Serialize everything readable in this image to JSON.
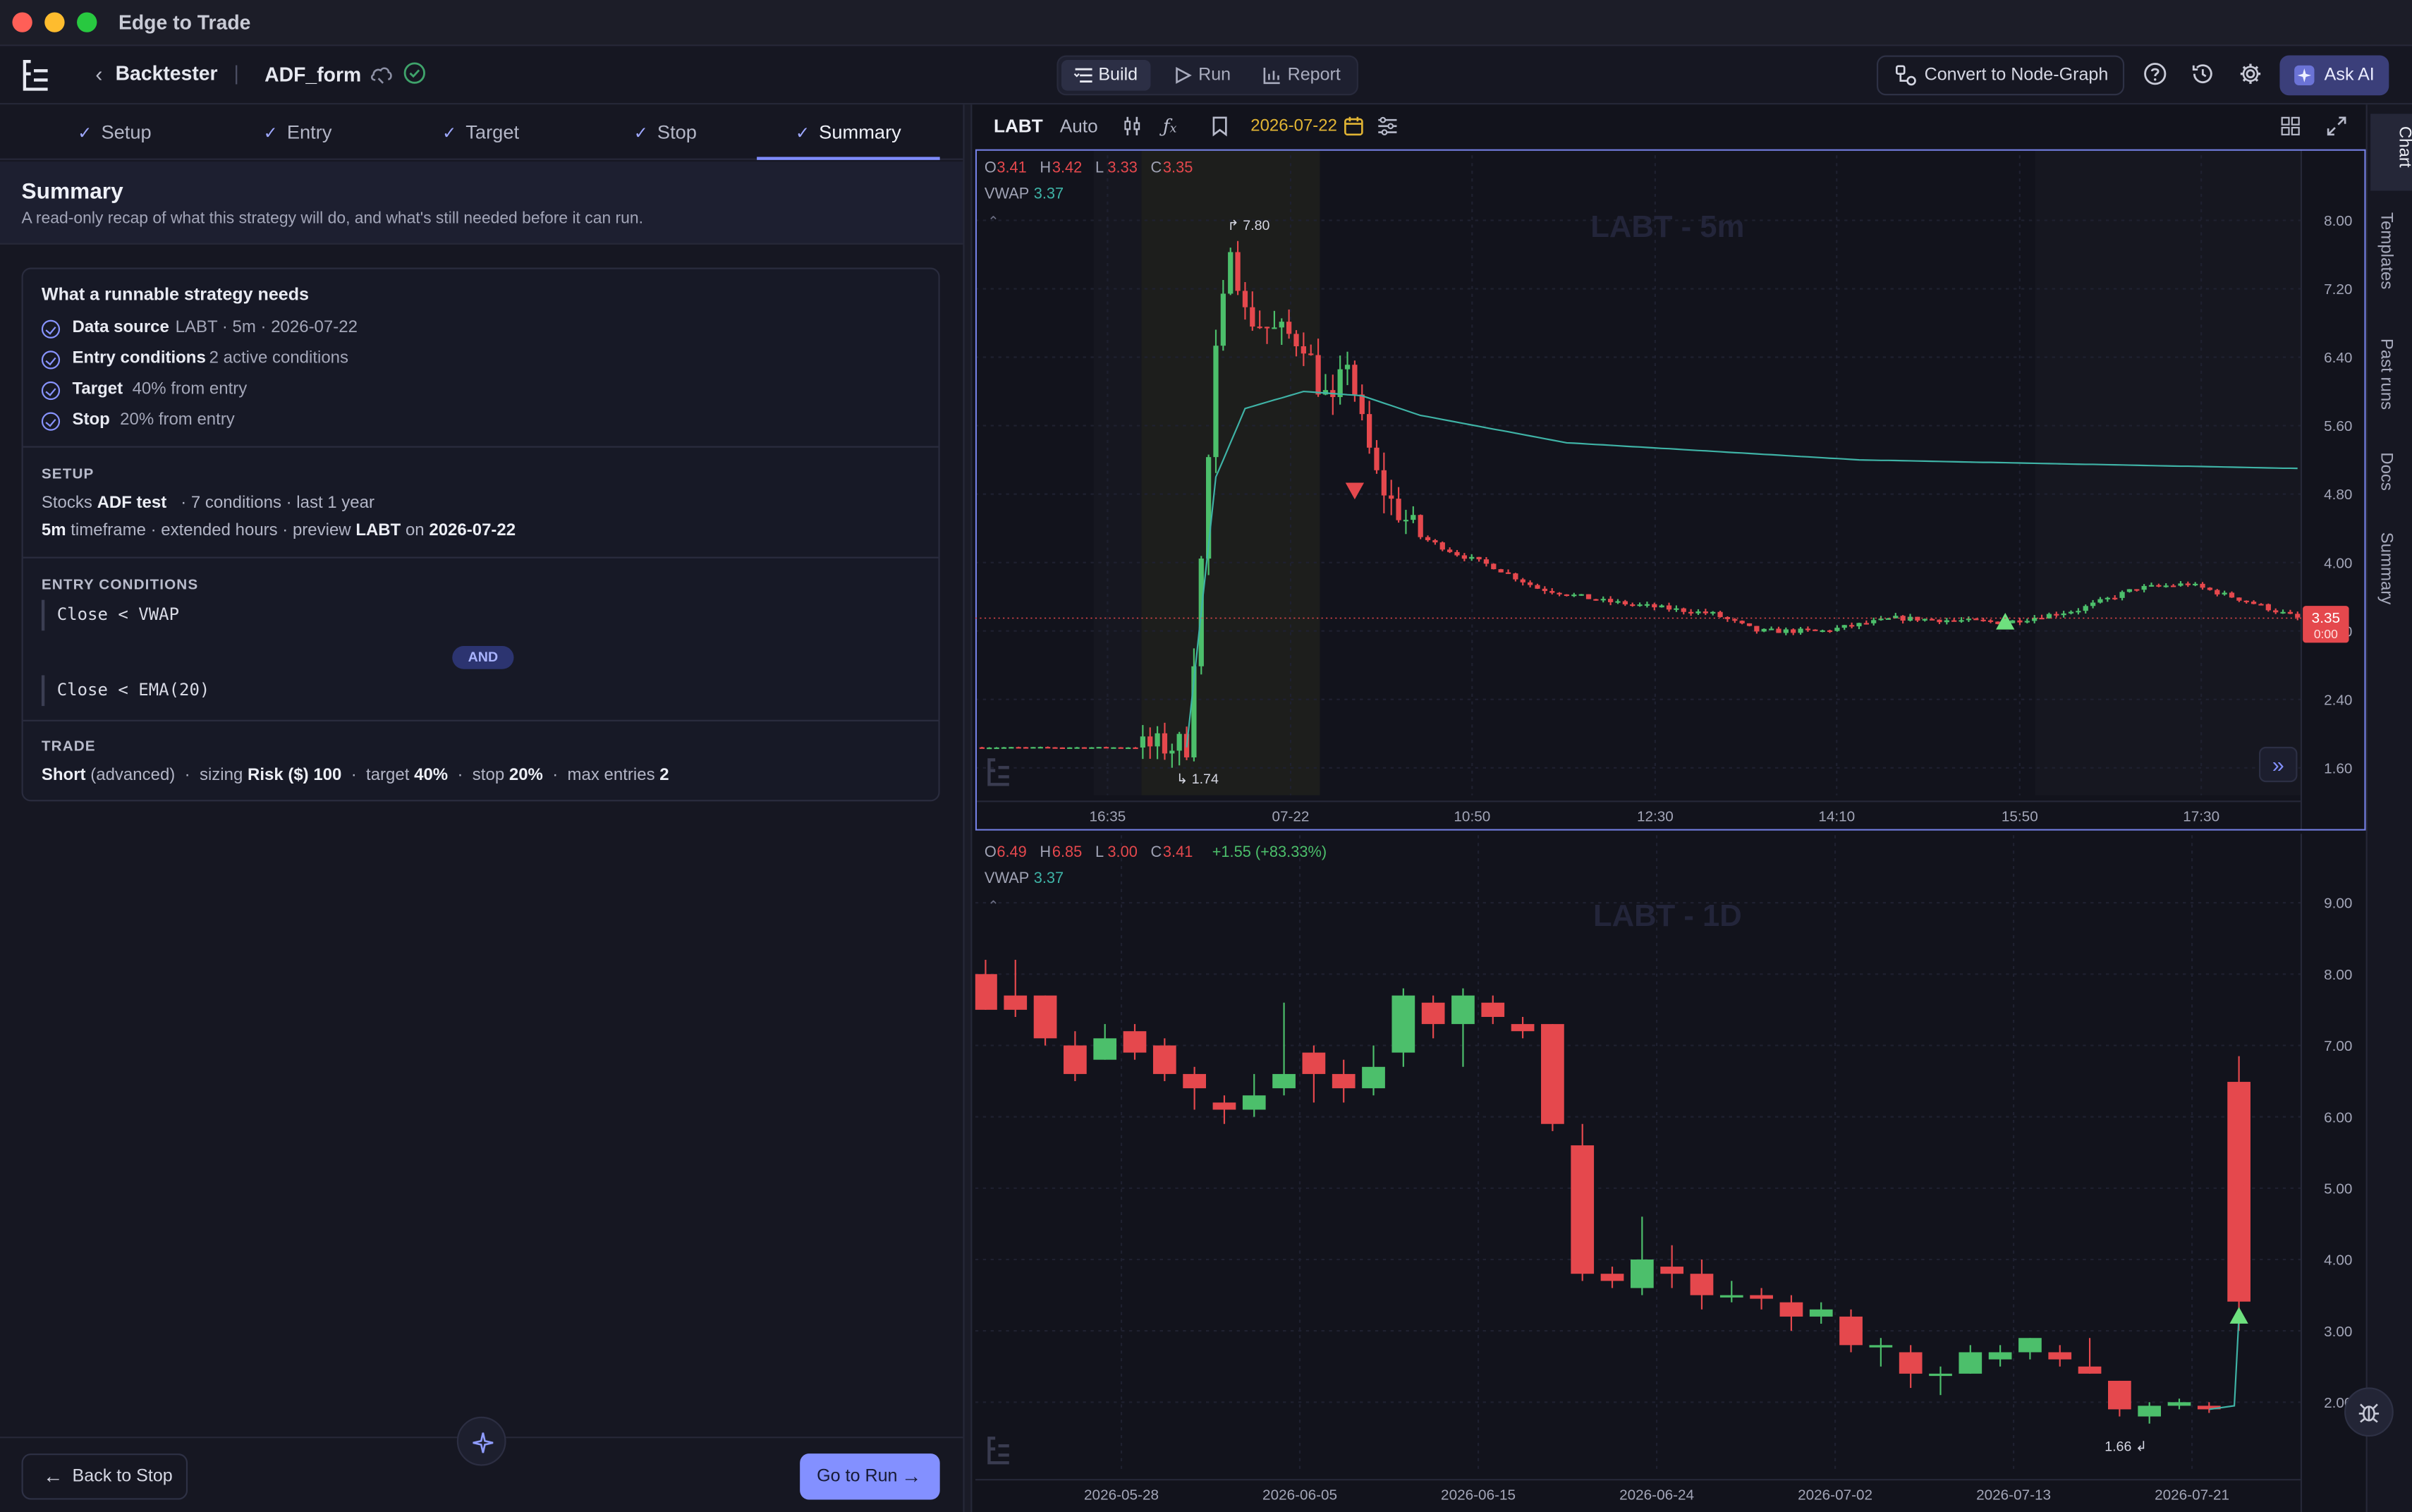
{
  "window": {
    "title": "Edge to Trade"
  },
  "header": {
    "breadcrumb": "Backtester",
    "strategy_name": "ADF_form",
    "modes": [
      {
        "label": "Build",
        "icon": "build-icon",
        "active": true
      },
      {
        "label": "Run",
        "icon": "play-icon",
        "active": false
      },
      {
        "label": "Report",
        "icon": "bar-chart-icon",
        "active": false
      }
    ],
    "convert_label": "Convert to Node-Graph",
    "ask_ai_label": "Ask AI"
  },
  "steps": [
    {
      "label": "Setup",
      "done": true
    },
    {
      "label": "Entry",
      "done": true
    },
    {
      "label": "Target",
      "done": true
    },
    {
      "label": "Stop",
      "done": true
    },
    {
      "label": "Summary",
      "done": true,
      "active": true
    }
  ],
  "summary": {
    "title": "Summary",
    "subtitle": "A read-only recap of what this strategy will do, and what's still needed before it can run.",
    "needs_title": "What a runnable strategy needs",
    "needs": [
      {
        "label": "Data source",
        "value": "LABT · 5m · 2026-07-22"
      },
      {
        "label": "Entry conditions",
        "value": "2 active conditions"
      },
      {
        "label": "Target",
        "value": "40% from entry"
      },
      {
        "label": "Stop",
        "value": "20% from entry"
      }
    ],
    "setup": {
      "label": "SETUP",
      "l1_pre": "Stocks",
      "l1_name": "ADF test",
      "l1_rest": "·   7 conditions   ·   last 1 year",
      "l2_tf": "5m",
      "l2_mid": "timeframe   ·   extended hours   ·   preview",
      "l2_sym": "LABT",
      "l2_on": "on",
      "l2_date": "2026-07-22"
    },
    "entry": {
      "label": "ENTRY CONDITIONS",
      "conditions": [
        "Close < VWAP",
        "Close < EMA(20)"
      ],
      "joiner": "AND"
    },
    "trade": {
      "label": "TRADE",
      "direction": "Short",
      "direction_note": "(advanced)",
      "sizing_label": "sizing",
      "sizing_value": "Risk ($) 100",
      "target_label": "target",
      "target_value": "40%",
      "stop_label": "stop",
      "stop_value": "20%",
      "max_label": "max entries",
      "max_value": "2"
    }
  },
  "footer": {
    "back_label": "Back to Stop",
    "next_label": "Go to Run"
  },
  "chart_toolbar": {
    "symbol": "LABT",
    "scale": "Auto",
    "date": "2026-07-22"
  },
  "rail": [
    "Chart",
    "Templates",
    "Past runs",
    "Docs",
    "Summary"
  ],
  "colors": {
    "up": "#4cbf6b",
    "down": "#e5484d",
    "accent": "#8390ff",
    "vwap": "#3fb3a6",
    "date": "#e2b534"
  },
  "chart_data": [
    {
      "type": "candlestick",
      "watermark": "LABT - 5m",
      "ohlc": {
        "o": "3.41",
        "h": "3.42",
        "l": "3.33",
        "c": "3.35"
      },
      "vwap_label": "VWAP",
      "vwap_value": "3.37",
      "yticks": [
        8.0,
        7.2,
        6.4,
        5.6,
        4.8,
        4.0,
        3.2,
        2.4,
        1.6
      ],
      "ylim": [
        1.28,
        8.4
      ],
      "xticks": [
        "16:35",
        "07-22",
        "10:50",
        "12:30",
        "14:10",
        "15:50",
        "17:30"
      ],
      "last_price": "3.35",
      "countdown": "0:00",
      "high_label": "7.80",
      "low_label": "1.74",
      "anchors": [
        [
          0,
          1.84
        ],
        [
          22,
          1.84
        ],
        [
          28,
          1.87
        ],
        [
          30,
          4.0
        ],
        [
          32,
          6.4
        ],
        [
          33,
          7.0
        ],
        [
          34,
          7.8
        ],
        [
          36,
          6.9
        ],
        [
          40,
          6.7
        ],
        [
          44,
          6.6
        ],
        [
          46,
          6.1
        ],
        [
          48,
          5.8
        ],
        [
          50,
          6.4
        ],
        [
          52,
          5.6
        ],
        [
          54,
          5.0
        ],
        [
          56,
          4.7
        ],
        [
          60,
          4.3
        ],
        [
          65,
          4.1
        ],
        [
          70,
          3.95
        ],
        [
          76,
          3.7
        ],
        [
          85,
          3.55
        ],
        [
          100,
          3.4
        ],
        [
          106,
          3.2
        ],
        [
          115,
          3.2
        ],
        [
          125,
          3.35
        ],
        [
          140,
          3.3
        ],
        [
          150,
          3.45
        ],
        [
          158,
          3.7
        ],
        [
          165,
          3.75
        ],
        [
          173,
          3.55
        ],
        [
          180,
          3.35
        ]
      ],
      "vwap_anchors": [
        [
          28,
          1.84
        ],
        [
          32,
          5.0
        ],
        [
          36,
          5.8
        ],
        [
          44,
          6.0
        ],
        [
          52,
          5.95
        ],
        [
          60,
          5.72
        ],
        [
          80,
          5.4
        ],
        [
          120,
          5.2
        ],
        [
          180,
          5.1
        ]
      ],
      "entry_markers": [
        [
          51,
          4.85,
          "down"
        ],
        [
          140,
          3.3,
          "up"
        ]
      ]
    },
    {
      "type": "candlestick",
      "watermark": "LABT - 1D",
      "ohlc": {
        "o": "6.49",
        "h": "6.85",
        "l": "3.00",
        "c": "3.41",
        "chg": "+1.55 (+83.33%)"
      },
      "vwap_label": "VWAP",
      "vwap_value": "3.37",
      "yticks": [
        9.0,
        8.0,
        7.0,
        6.0,
        5.0,
        4.0,
        3.0,
        2.0
      ],
      "ylim": [
        1.0,
        9.3
      ],
      "xticks": [
        "2026-05-28",
        "2026-06-05",
        "2026-06-15",
        "2026-06-24",
        "2026-07-02",
        "2026-07-13",
        "2026-07-21"
      ],
      "low_label": "1.66",
      "candles": [
        [
          8.0,
          7.5,
          8.2,
          7.5
        ],
        [
          7.7,
          7.5,
          8.2,
          7.4
        ],
        [
          7.7,
          7.1,
          7.7,
          7.0
        ],
        [
          7.0,
          6.6,
          7.2,
          6.5
        ],
        [
          6.8,
          7.1,
          7.3,
          6.8
        ],
        [
          7.2,
          6.9,
          7.3,
          6.8
        ],
        [
          7.0,
          6.6,
          7.1,
          6.5
        ],
        [
          6.6,
          6.4,
          6.7,
          6.1
        ],
        [
          6.2,
          6.1,
          6.3,
          5.9
        ],
        [
          6.1,
          6.3,
          6.6,
          6.0
        ],
        [
          6.4,
          6.6,
          7.6,
          6.3
        ],
        [
          6.9,
          6.6,
          7.0,
          6.2
        ],
        [
          6.6,
          6.4,
          6.8,
          6.2
        ],
        [
          6.4,
          6.7,
          7.0,
          6.3
        ],
        [
          6.9,
          7.7,
          7.8,
          6.7
        ],
        [
          7.6,
          7.3,
          7.7,
          7.1
        ],
        [
          7.3,
          7.7,
          7.8,
          6.7
        ],
        [
          7.6,
          7.4,
          7.7,
          7.3
        ],
        [
          7.3,
          7.2,
          7.4,
          7.1
        ],
        [
          7.3,
          5.9,
          7.3,
          5.8
        ],
        [
          5.6,
          3.8,
          5.9,
          3.7
        ],
        [
          3.8,
          3.7,
          3.9,
          3.6
        ],
        [
          3.6,
          4.0,
          4.6,
          3.5
        ],
        [
          3.9,
          3.8,
          4.2,
          3.6
        ],
        [
          3.8,
          3.5,
          4.0,
          3.3
        ],
        [
          3.5,
          3.5,
          3.7,
          3.4
        ],
        [
          3.5,
          3.45,
          3.6,
          3.3
        ],
        [
          3.4,
          3.2,
          3.5,
          3.0
        ],
        [
          3.2,
          3.3,
          3.4,
          3.1
        ],
        [
          3.2,
          2.8,
          3.3,
          2.7
        ],
        [
          2.8,
          2.8,
          2.9,
          2.5
        ],
        [
          2.7,
          2.4,
          2.8,
          2.2
        ],
        [
          2.4,
          2.4,
          2.5,
          2.1
        ],
        [
          2.4,
          2.7,
          2.8,
          2.4
        ],
        [
          2.6,
          2.7,
          2.8,
          2.5
        ],
        [
          2.7,
          2.9,
          2.9,
          2.6
        ],
        [
          2.7,
          2.6,
          2.8,
          2.5
        ],
        [
          2.5,
          2.4,
          2.9,
          2.4
        ],
        [
          2.3,
          1.9,
          2.3,
          1.8
        ],
        [
          1.8,
          1.95,
          2.0,
          1.7
        ],
        [
          1.95,
          2.0,
          2.05,
          1.9
        ],
        [
          1.95,
          1.9,
          2.0,
          1.85
        ],
        [
          6.49,
          3.41,
          6.85,
          3.0
        ]
      ],
      "entry_markers": [
        [
          42,
          5.0,
          "down"
        ],
        [
          42,
          3.2,
          "up"
        ]
      ]
    }
  ]
}
